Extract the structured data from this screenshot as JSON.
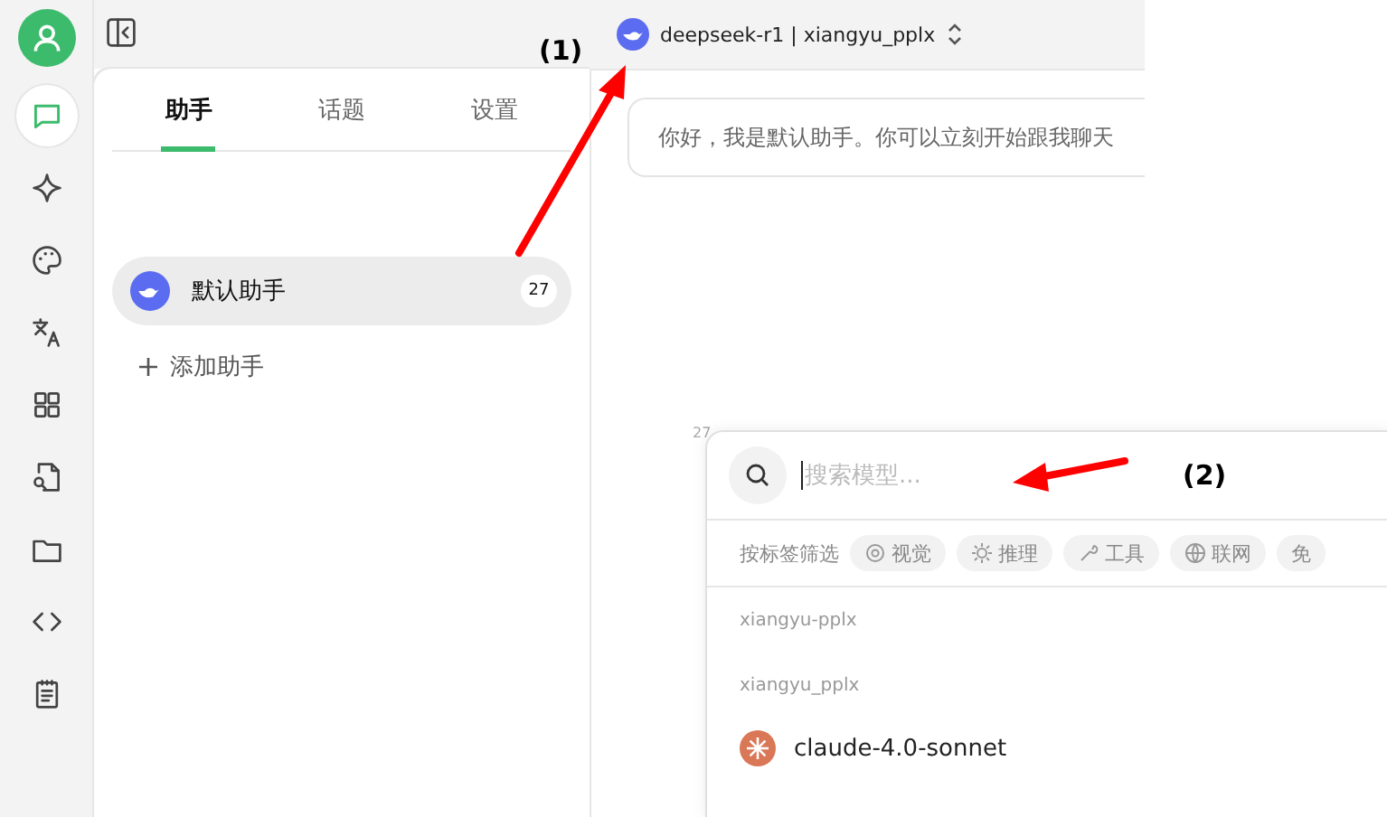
{
  "rail": {
    "items": [
      {
        "selected": true
      },
      {
        "selected": false
      },
      {
        "selected": false
      },
      {
        "selected": false
      },
      {
        "selected": false
      },
      {
        "selected": false
      },
      {
        "selected": false
      },
      {
        "selected": false
      },
      {
        "selected": false
      }
    ]
  },
  "tabs": [
    {
      "label": "助手",
      "selected": true
    },
    {
      "label": "话题",
      "selected": false
    },
    {
      "label": "设置",
      "selected": false
    }
  ],
  "assistants": [
    {
      "name": "默认助手",
      "count": "27",
      "selected": true
    }
  ],
  "add_assistant": "添加助手",
  "header": {
    "model": "deepseek-r1 | xiangyu_pplx"
  },
  "chat": {
    "greeting": "你好，我是默认助手。你可以立刻开始跟我聊天",
    "badge": "27"
  },
  "model_picker": {
    "placeholder": "搜索模型...",
    "filter_label": "按标签筛选",
    "tags": [
      "视觉",
      "推理",
      "工具",
      "联网",
      "免"
    ],
    "groups": [
      "xiangyu-pplx",
      "xiangyu_pplx"
    ],
    "models": [
      {
        "name": "claude-4.0-sonnet"
      }
    ]
  },
  "annotations": [
    "(1)",
    "(2)"
  ]
}
